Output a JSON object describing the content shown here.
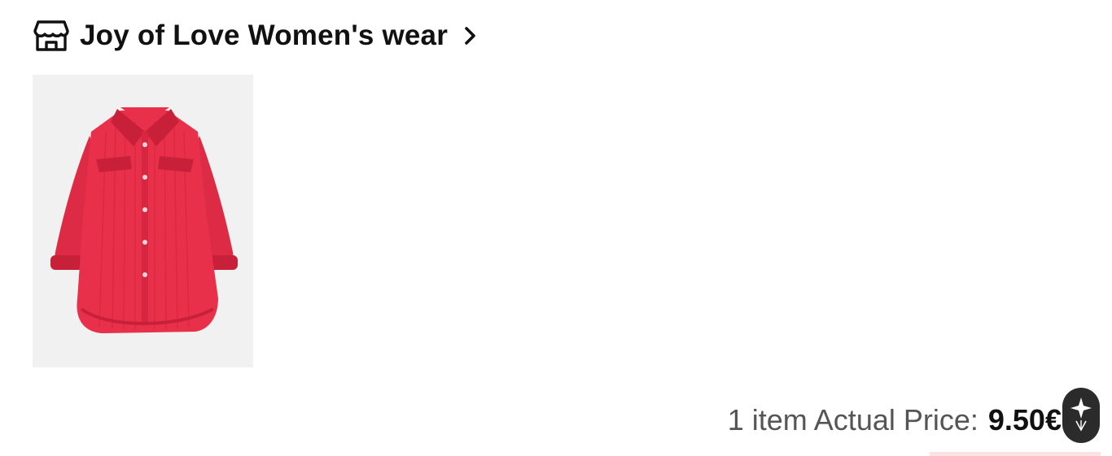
{
  "store": {
    "name": "Joy of Love Women's wear",
    "icon": "store-icon",
    "chevron_icon": "chevron-right-icon"
  },
  "product": {
    "image": "red-corduroy-shirt",
    "color": "#e8304a"
  },
  "summary": {
    "label": "1 item Actual Price:",
    "price": "9.50",
    "currency": "€"
  },
  "assistant": {
    "icon": "sparkle-assistant-icon"
  }
}
